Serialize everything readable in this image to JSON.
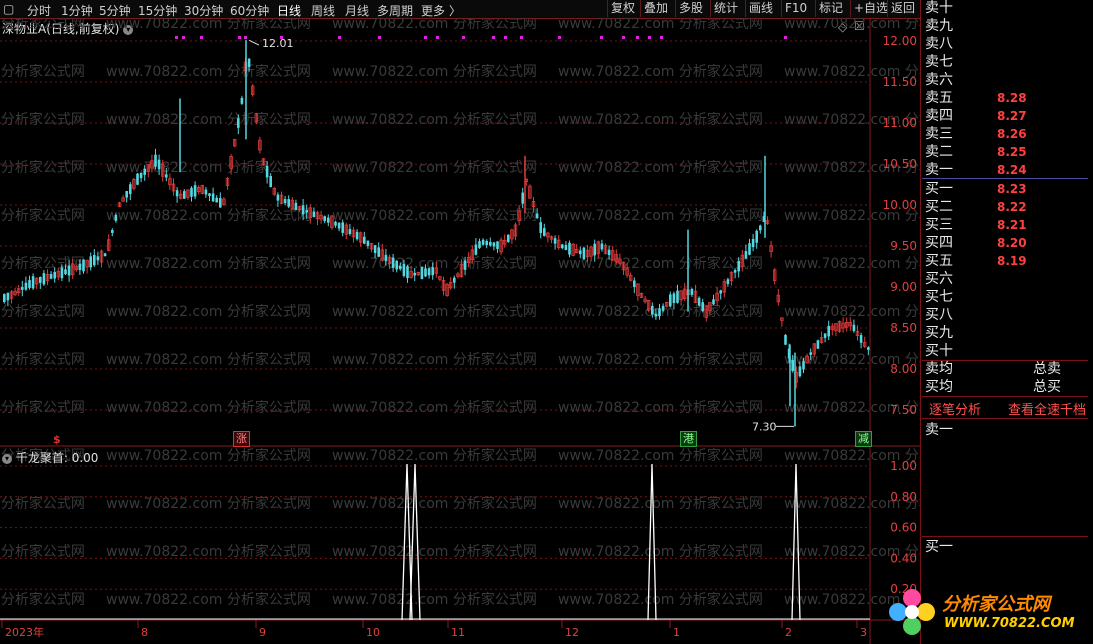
{
  "toolbar": {
    "left_items": [
      "分时",
      "1分钟",
      "5分钟",
      "15分钟",
      "30分钟",
      "60分钟",
      "日线",
      "周线",
      "月线",
      "多周期",
      "更多"
    ],
    "active_item": "日线",
    "more_arrow": "〉",
    "right_items": [
      "复权",
      "叠加",
      "多股",
      "统计",
      "画线",
      "F10",
      "标记",
      "+自选",
      "返回"
    ]
  },
  "chart": {
    "title": "深物业A(日线,前复权)",
    "price_axis": [
      "12.00",
      "11.50",
      "11.00",
      "10.50",
      "10.00",
      "9.50",
      "9.00",
      "8.50",
      "8.00",
      "7.50"
    ],
    "high_marker": "12.01",
    "low_marker": "7.30",
    "badges": [
      {
        "label": "$",
        "color": "#e03030"
      },
      {
        "label": "涨",
        "color": "#e03030"
      },
      {
        "label": "港",
        "color": "#30a040"
      },
      {
        "label": "减",
        "color": "#30a040"
      }
    ],
    "watermark": "www.70822.com 分析家公式网"
  },
  "indicator": {
    "title": "千龙聚首",
    "value": ": 0.00",
    "axis": [
      "1.00",
      "0.80",
      "0.60",
      "0.40",
      "0.20"
    ]
  },
  "xaxis": [
    "2023年",
    "8",
    "9",
    "10",
    "11",
    "12",
    "1",
    "2",
    "3"
  ],
  "order_book": {
    "sell_labels": [
      "卖十",
      "卖九",
      "卖八",
      "卖七",
      "卖六",
      "卖五",
      "卖四",
      "卖三",
      "卖二",
      "卖一"
    ],
    "sell_prices": [
      "",
      "",
      "",
      "",
      "",
      "8.28",
      "8.27",
      "8.26",
      "8.25",
      "8.24"
    ],
    "buy_labels": [
      "买一",
      "买二",
      "买三",
      "买四",
      "买五",
      "买六",
      "买七",
      "买八",
      "买九",
      "买十"
    ],
    "buy_prices": [
      "8.23",
      "8.22",
      "8.21",
      "8.20",
      "8.19",
      "",
      "",
      "",
      "",
      ""
    ],
    "avg_sell": "卖均",
    "avg_buy": "买均",
    "total_sell": "总卖",
    "total_buy": "总买",
    "tab_tick": "逐笔分析",
    "tab_full": "查看全速千档",
    "lower_sell": "卖一",
    "lower_buy": "买一"
  },
  "logo": {
    "text": "分析家公式网",
    "url": "WWW.70822.COM"
  },
  "colors": {
    "up": "#e03a3a",
    "down": "#52d8e0",
    "grid": "#7a1414",
    "price_text": "#e04040"
  }
}
